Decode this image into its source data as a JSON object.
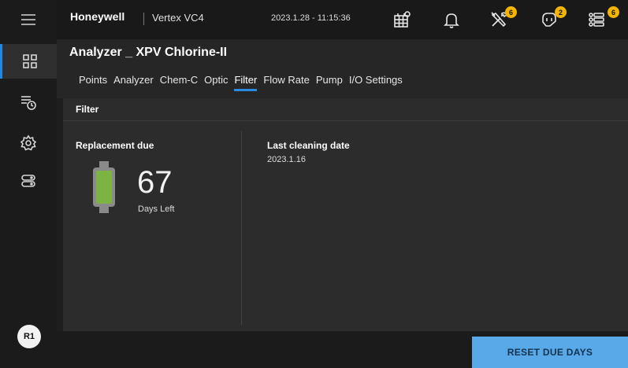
{
  "header": {
    "brand": "Honeywell",
    "model": "Vertex VC4",
    "datetime": "2023.1.28 - 11:15:36",
    "maintenance_badge": "6",
    "alarm_badge": "2",
    "list_badge": "6"
  },
  "page": {
    "title": "Analyzer _ XPV Chlorine-II",
    "tabs": [
      "Points",
      "Analyzer",
      "Chem-C",
      "Optic",
      "Filter",
      "Flow Rate",
      "Pump",
      "I/O Settings"
    ],
    "active_tab": "Filter"
  },
  "filter": {
    "card_title": "Filter",
    "replacement_label": "Replacement due",
    "days_left_value": "67",
    "days_left_label": "Days Left",
    "status_color": "#7cb342",
    "last_cleaning_label": "Last cleaning date",
    "last_cleaning_date": "2023.1.16"
  },
  "footer": {
    "reset_label": "RESET DUE DAYS"
  },
  "user": {
    "avatar": "R1"
  }
}
